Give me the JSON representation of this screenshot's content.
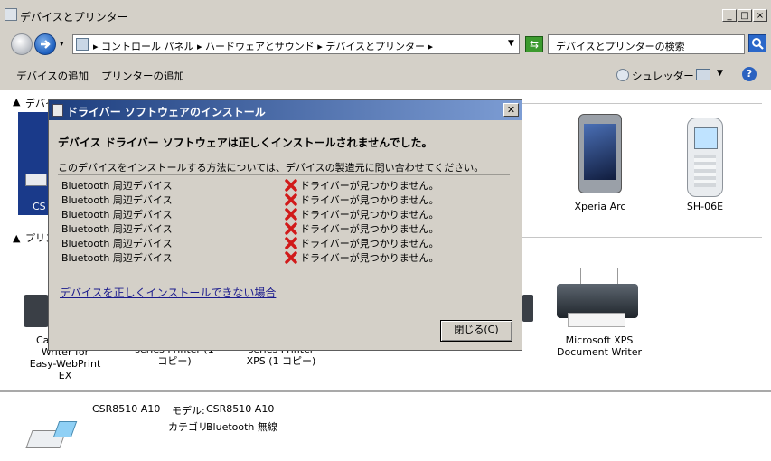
{
  "window": {
    "title": "デバイスとプリンター",
    "controls": [
      "_",
      "□",
      "×"
    ]
  },
  "address": {
    "path": "▸ コントロール パネル ▸ ハードウェアとサウンド ▸ デバイスとプリンター ▸",
    "search_placeholder": "デバイスとプリンターの検索"
  },
  "toolbar": {
    "add_device": "デバイスの追加",
    "add_printer": "プリンターの追加",
    "shredder": "シュレッダー"
  },
  "groups": {
    "devices_partial": "デバイ",
    "printers_partial": "プリン"
  },
  "devices": [
    {
      "label": "CS",
      "icon": "usb-adapter-icon"
    },
    {
      "label": "Xperia Arc",
      "icon": "smartphone-icon"
    },
    {
      "label": "SH-06E",
      "icon": "feature-phone-icon"
    }
  ],
  "printers": [
    {
      "label_lines": [
        "Ca",
        "Writer for",
        "Easy-WebPrint",
        "EX"
      ]
    },
    {
      "label_lines": [
        "series Printer (1",
        "コピー)"
      ]
    },
    {
      "label_lines": [
        "series Printer",
        "XPS (1 コピー)"
      ]
    },
    {
      "label_lines": [
        "Microsoft XPS",
        "Document Writer"
      ]
    }
  ],
  "details": {
    "name": "CSR8510 A10",
    "model_label": "モデル:",
    "model_value": "CSR8510 A10",
    "category_label": "カテゴリ:",
    "category_value": "Bluetooth 無線"
  },
  "dialog": {
    "title": "ドライバー ソフトウェアのインストール",
    "heading": "デバイス ドライバー ソフトウェアは正しくインストールされませんでした。",
    "info": "このデバイスをインストールする方法については、デバイスの製造元に問い合わせてください。",
    "rows": [
      {
        "name": "Bluetooth 周辺デバイス",
        "status": "ドライバーが見つかりません。"
      },
      {
        "name": "Bluetooth 周辺デバイス",
        "status": "ドライバーが見つかりません。"
      },
      {
        "name": "Bluetooth 周辺デバイス",
        "status": "ドライバーが見つかりません。"
      },
      {
        "name": "Bluetooth 周辺デバイス",
        "status": "ドライバーが見つかりません。"
      },
      {
        "name": "Bluetooth 周辺デバイス",
        "status": "ドライバーが見つかりません。"
      },
      {
        "name": "Bluetooth 周辺デバイス",
        "status": "ドライバーが見つかりません。"
      }
    ],
    "help_link": "デバイスを正しくインストールできない場合",
    "close_button": "閉じる(C)"
  }
}
